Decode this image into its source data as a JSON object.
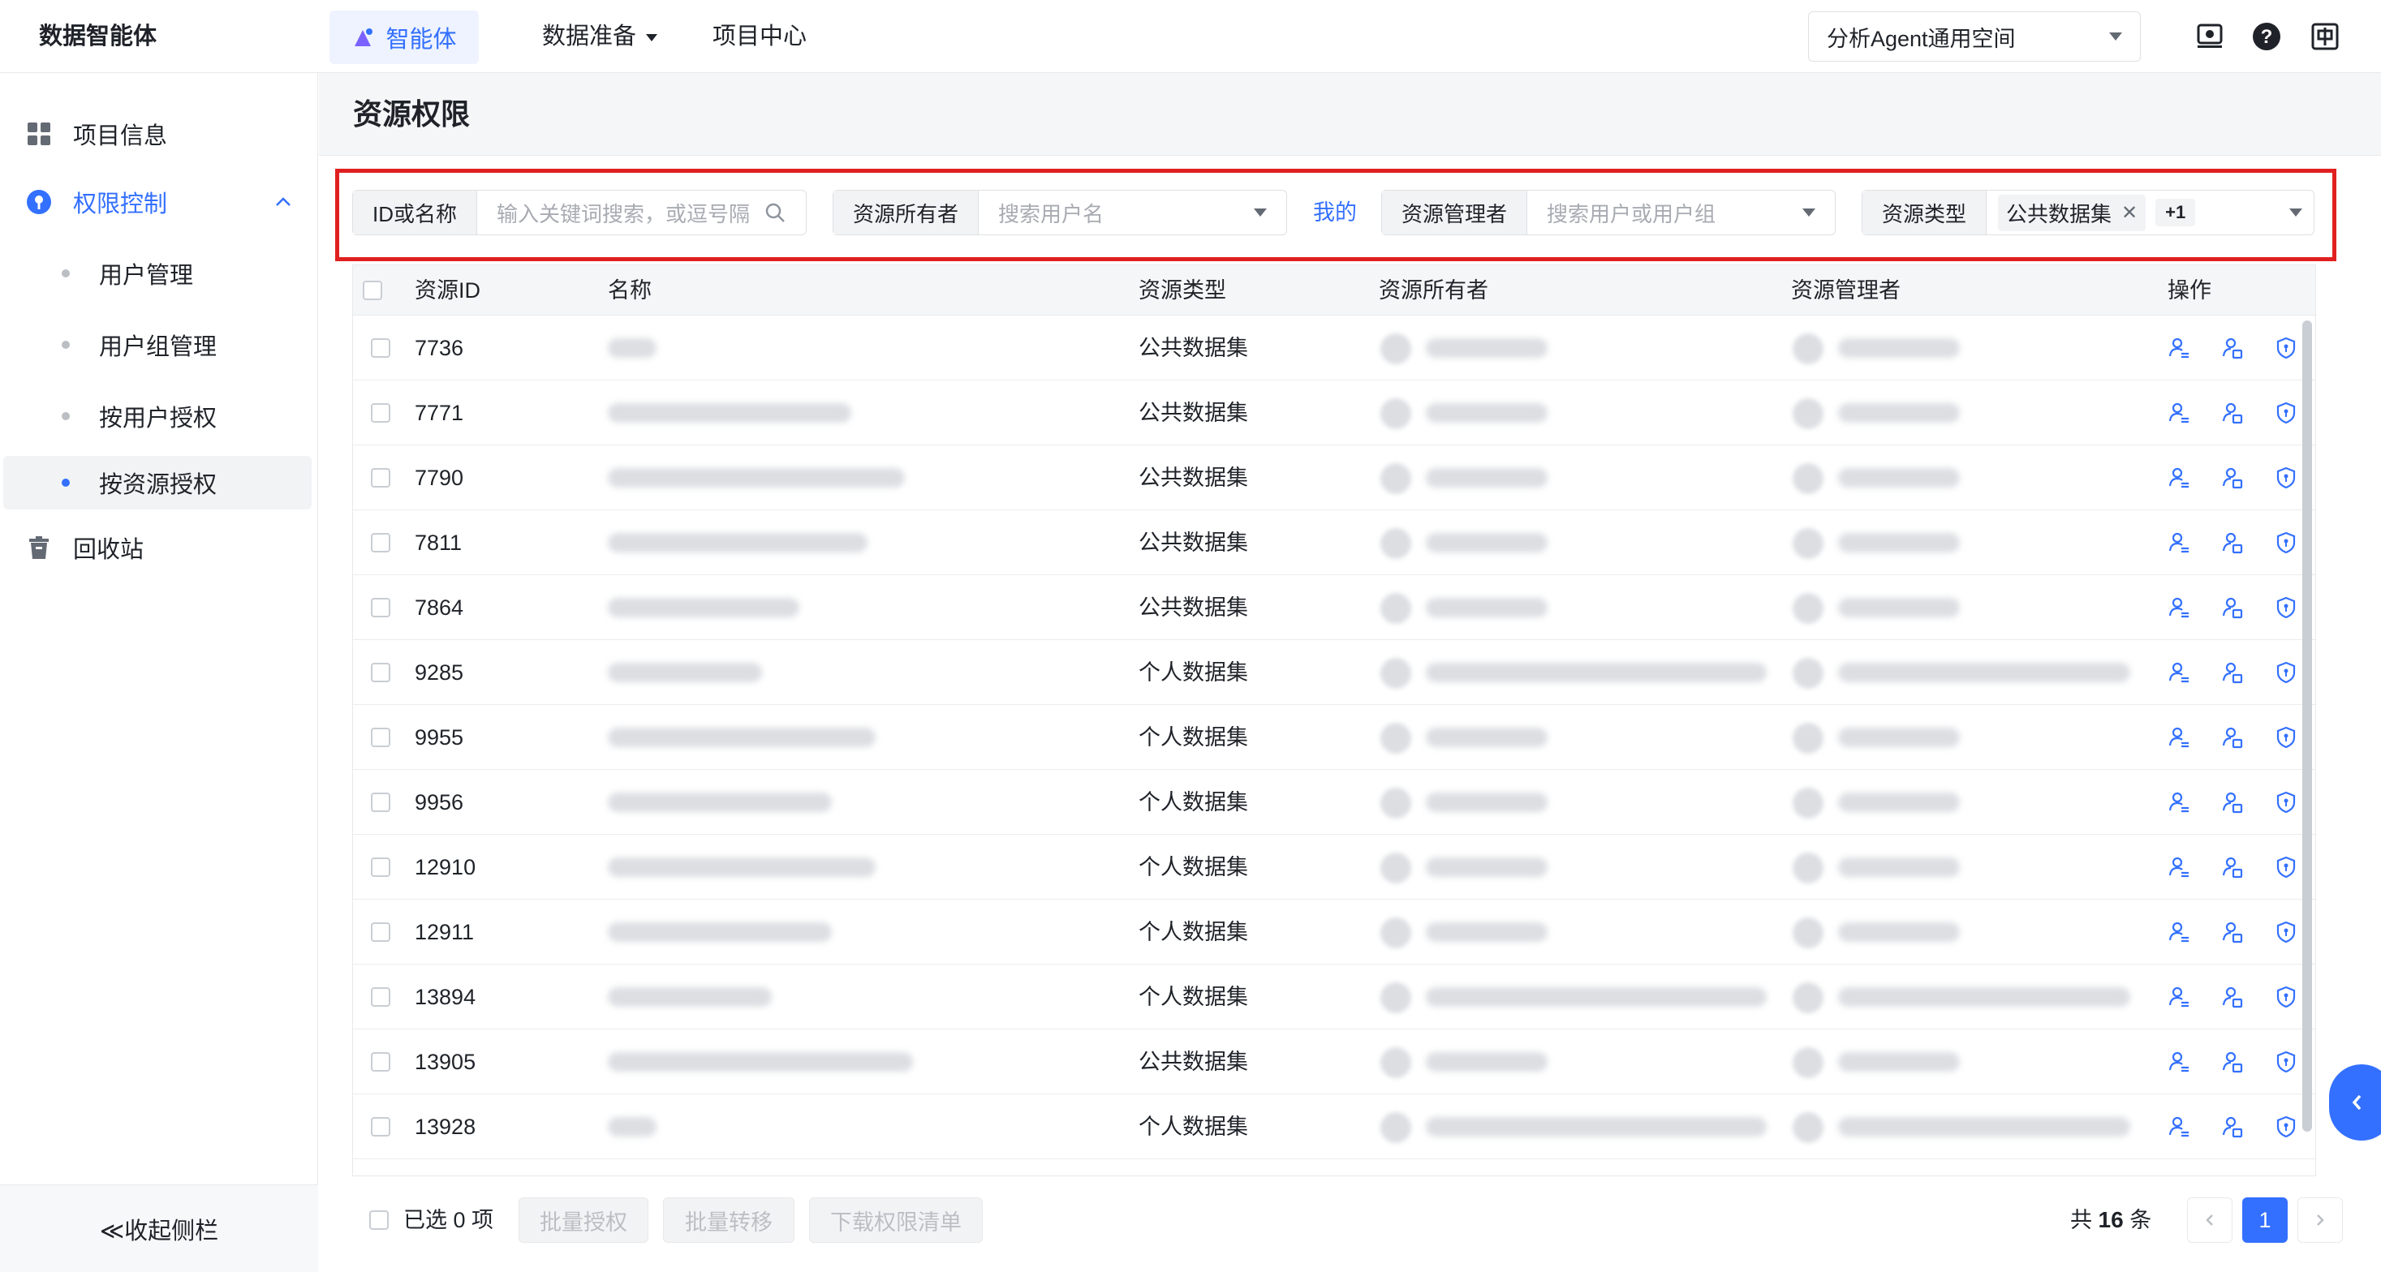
{
  "brand": "数据智能体",
  "topnav": {
    "agent_label": "智能体",
    "data_prep_label": "数据准备",
    "project_center_label": "项目中心",
    "workspace_label": "分析Agent通用空间"
  },
  "sidebar": {
    "project_info": "项目信息",
    "permission_control": "权限控制",
    "user_manage": "用户管理",
    "group_manage": "用户组管理",
    "by_user": "按用户授权",
    "by_resource": "按资源授权",
    "recycle": "回收站",
    "collapse_label": "≪收起侧栏"
  },
  "page": {
    "title": "资源权限"
  },
  "filters": {
    "id_label": "ID或名称",
    "id_placeholder": "输入关键词搜索，或逗号隔",
    "owner_label": "资源所有者",
    "owner_placeholder": "搜索用户名",
    "mine_label": "我的",
    "manager_label": "资源管理者",
    "manager_placeholder": "搜索用户或用户组",
    "type_label": "资源类型",
    "type_tag": "公共数据集",
    "type_more": "+1"
  },
  "table": {
    "headers": {
      "id": "资源ID",
      "name": "名称",
      "type": "资源类型",
      "owner": "资源所有者",
      "manager": "资源管理者",
      "ops": "操作"
    },
    "rows": [
      {
        "id": "7736",
        "type": "公共数据集"
      },
      {
        "id": "7771",
        "type": "公共数据集"
      },
      {
        "id": "7790",
        "type": "公共数据集"
      },
      {
        "id": "7811",
        "type": "公共数据集"
      },
      {
        "id": "7864",
        "type": "公共数据集"
      },
      {
        "id": "9285",
        "type": "个人数据集"
      },
      {
        "id": "9955",
        "type": "个人数据集"
      },
      {
        "id": "9956",
        "type": "个人数据集"
      },
      {
        "id": "12910",
        "type": "个人数据集"
      },
      {
        "id": "12911",
        "type": "个人数据集"
      },
      {
        "id": "13894",
        "type": "个人数据集"
      },
      {
        "id": "13905",
        "type": "公共数据集"
      },
      {
        "id": "13928",
        "type": "个人数据集"
      }
    ]
  },
  "footer": {
    "selected": "已选 0 项",
    "batch_grant": "批量授权",
    "batch_transfer": "批量转移",
    "download": "下载权限清单",
    "total_prefix": "共",
    "total_count": "16",
    "total_suffix": "条",
    "current_page": "1"
  },
  "colors": {
    "accent": "#3370ff",
    "highlight": "#e02020"
  }
}
